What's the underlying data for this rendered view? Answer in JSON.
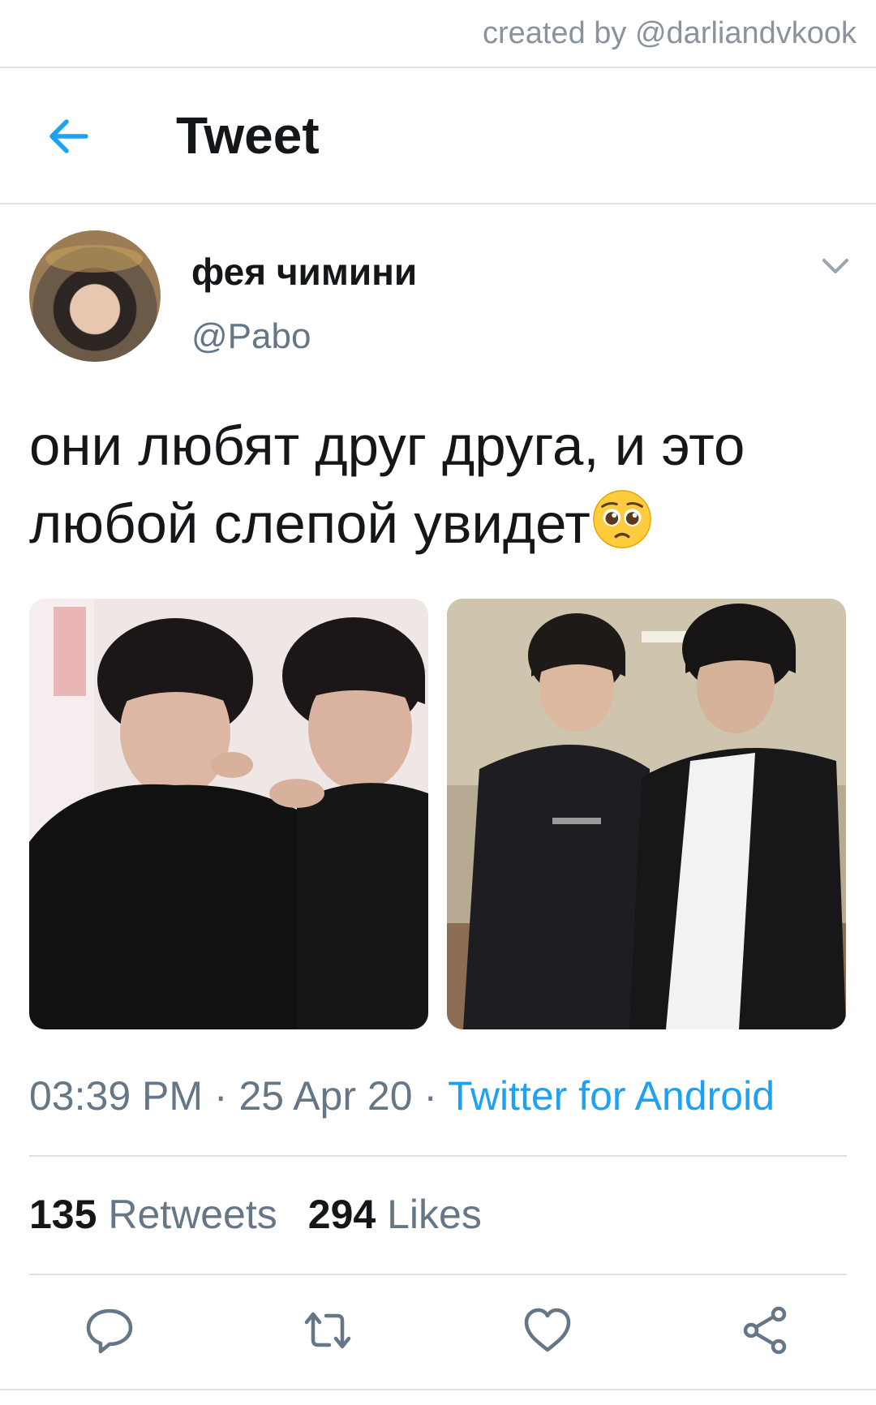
{
  "watermark": {
    "text": "created by @darliandvkook"
  },
  "header": {
    "title": "Tweet",
    "back_icon": "arrow-left-icon"
  },
  "tweet": {
    "author_name": "фея чимини",
    "author_handle": "@Pabo",
    "text": "они любят друг друга, и это любой слепой увидет",
    "emoji": "pleading-face",
    "images": [
      "photo-1",
      "photo-2"
    ],
    "timestamp": "03:39 PM · 25 Apr 20 · ",
    "source": "Twitter for Android",
    "retweets_count": "135",
    "retweets_label": " Retweets",
    "likes_count": "294",
    "likes_label": " Likes"
  },
  "actions": {
    "reply_icon": "reply-icon",
    "retweet_icon": "retweet-icon",
    "like_icon": "heart-icon",
    "share_icon": "share-icon"
  },
  "colors": {
    "accent": "#1da1f2",
    "secondary_text": "#657786",
    "divider": "#dde1e6"
  }
}
